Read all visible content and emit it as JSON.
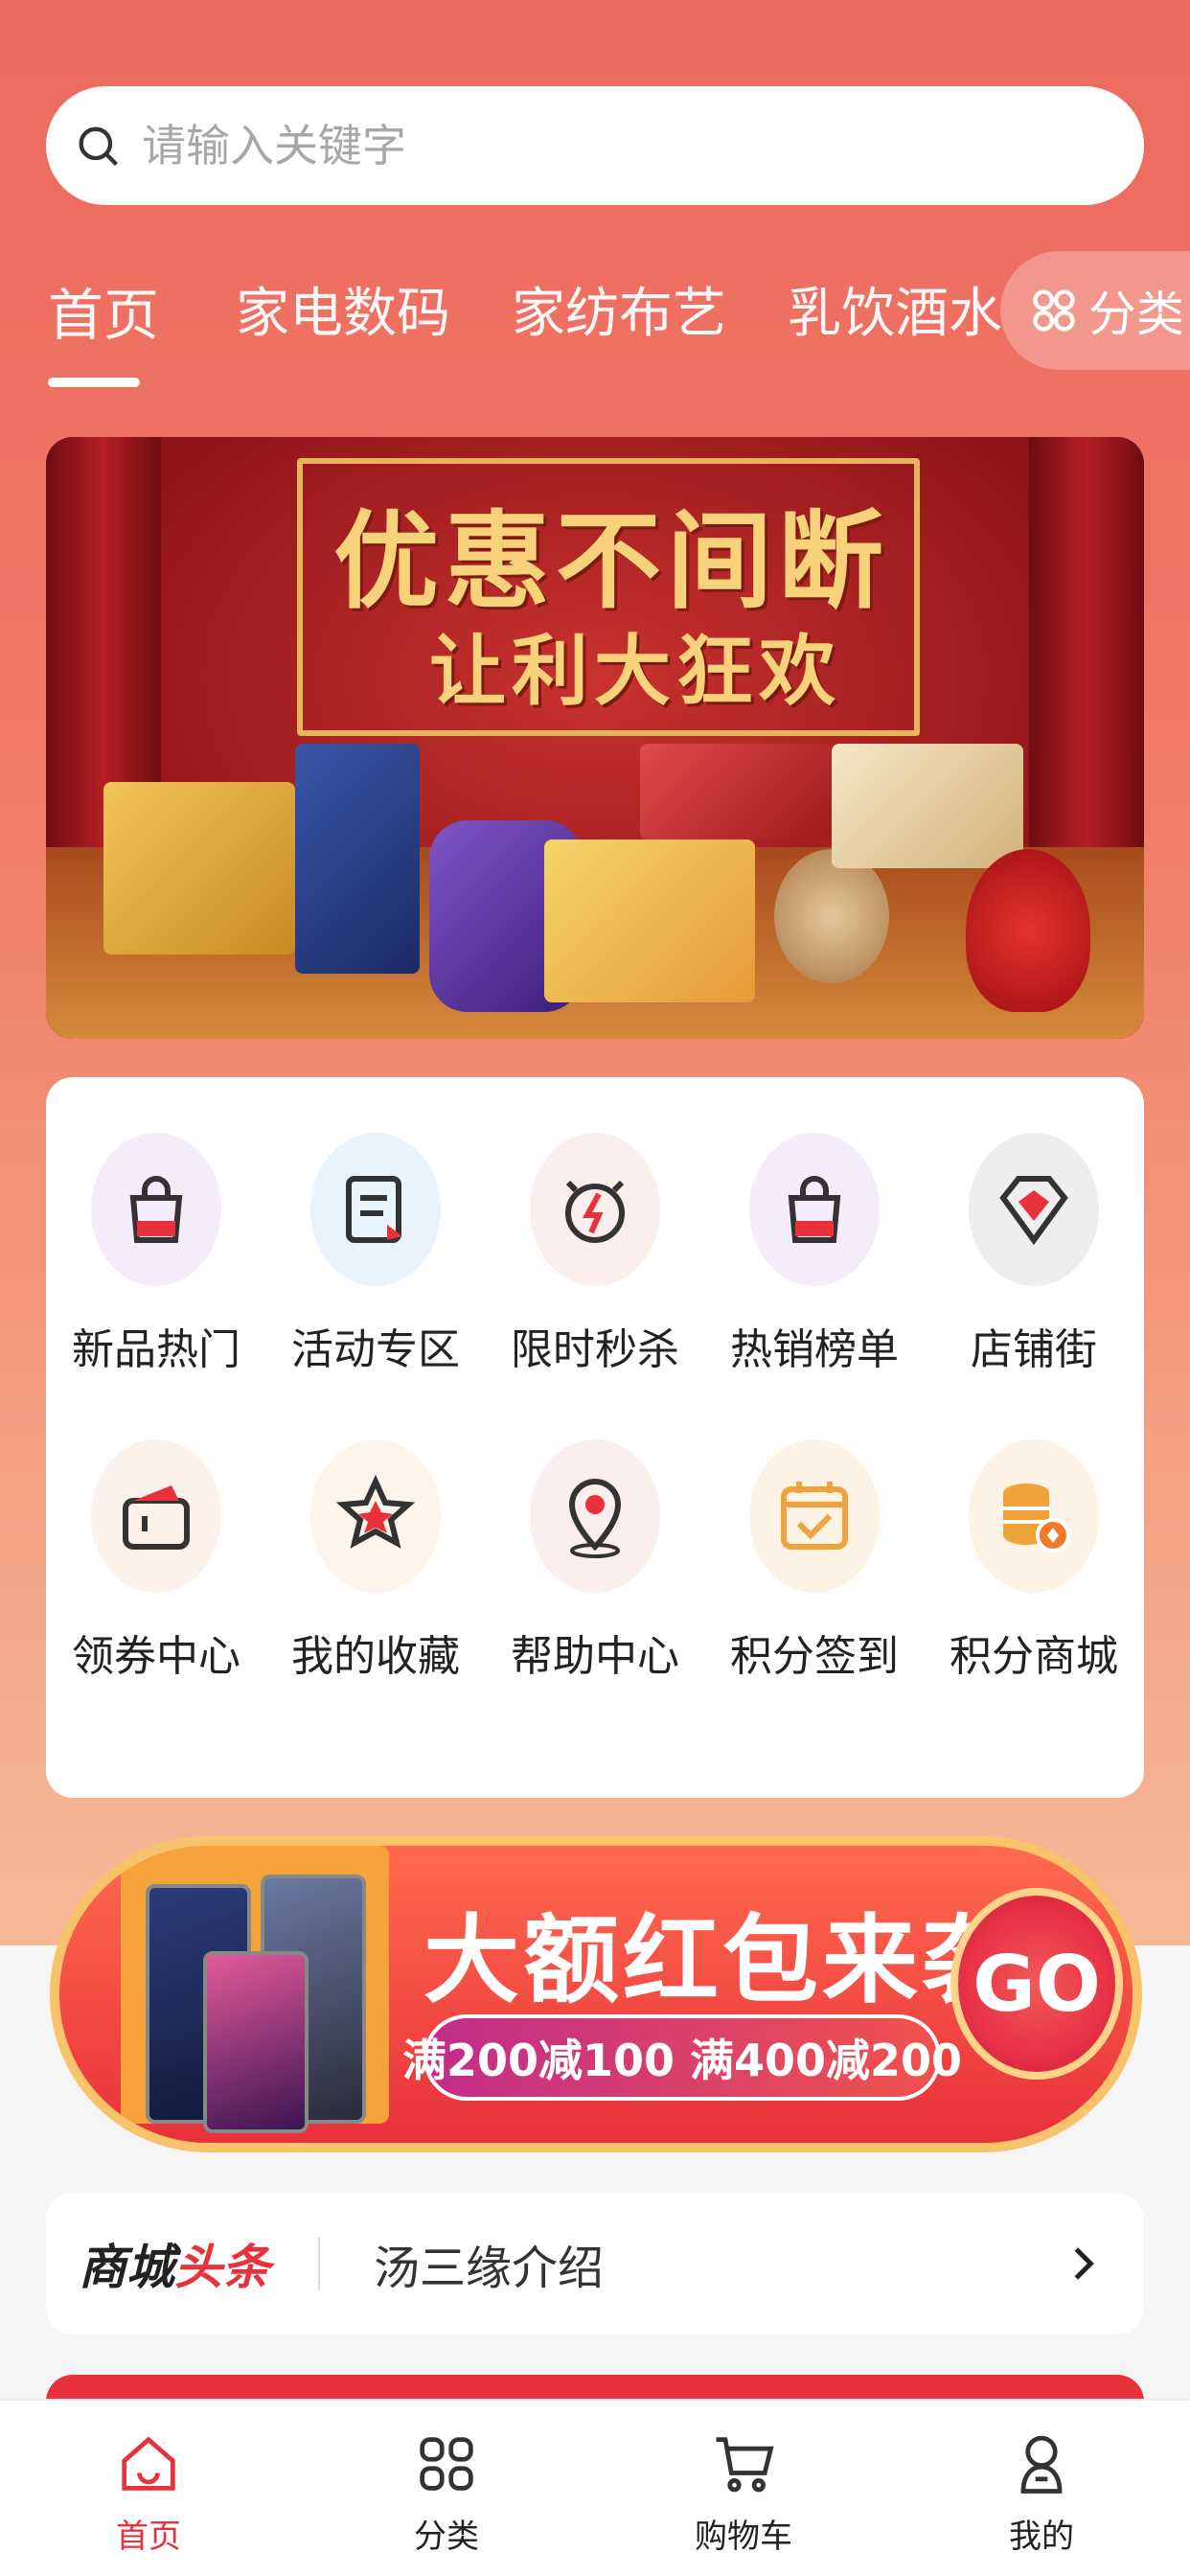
{
  "search": {
    "placeholder": "请输入关键字"
  },
  "nav_tabs": [
    {
      "label": "首页",
      "active": true
    },
    {
      "label": "家电数码"
    },
    {
      "label": "家纺布艺"
    },
    {
      "label": "乳饮酒水"
    }
  ],
  "category_button": {
    "label": "分类"
  },
  "banner": {
    "title_line1": "优惠不间断",
    "title_line2": "让利大狂欢"
  },
  "quick_menu": [
    {
      "label": "新品热门",
      "icon": "shopping-bag-icon"
    },
    {
      "label": "活动专区",
      "icon": "document-icon"
    },
    {
      "label": "限时秒杀",
      "icon": "alarm-clock-icon"
    },
    {
      "label": "热销榜单",
      "icon": "shopping-bag-icon"
    },
    {
      "label": "店铺街",
      "icon": "diamond-icon"
    },
    {
      "label": "领券中心",
      "icon": "coupon-icon"
    },
    {
      "label": "我的收藏",
      "icon": "star-icon"
    },
    {
      "label": "帮助中心",
      "icon": "location-pin-icon"
    },
    {
      "label": "积分签到",
      "icon": "calendar-check-icon"
    },
    {
      "label": "积分商城",
      "icon": "coins-icon"
    }
  ],
  "promo": {
    "title": "大额红包来袭",
    "offer": "满200减100 满400减200",
    "go_label": "GO"
  },
  "headline": {
    "brand_black": "商城",
    "brand_red": "头条",
    "text": "汤三缘介绍"
  },
  "tabbar": [
    {
      "label": "首页",
      "active": true
    },
    {
      "label": "分类"
    },
    {
      "label": "购物车"
    },
    {
      "label": "我的"
    }
  ],
  "colors": {
    "accent": "#e8313b",
    "header_bg": "#ec6a5e"
  }
}
